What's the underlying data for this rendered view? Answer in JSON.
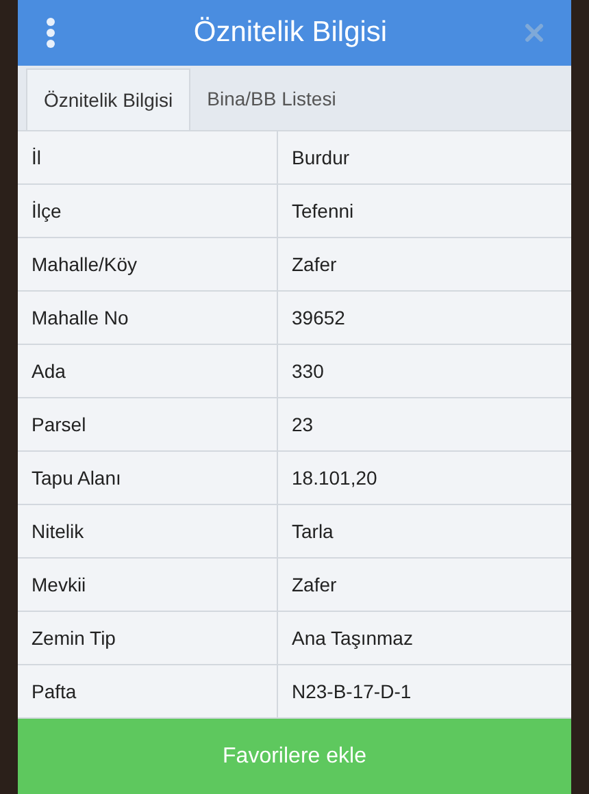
{
  "dialog": {
    "title": "Öznitelik Bilgisi"
  },
  "tabs": [
    {
      "label": "Öznitelik Bilgisi",
      "selected": true
    },
    {
      "label": "Bina/BB Listesi",
      "selected": false
    }
  ],
  "rows": [
    {
      "name": "İl",
      "value": "Burdur"
    },
    {
      "name": "İlçe",
      "value": "Tefenni"
    },
    {
      "name": "Mahalle/Köy",
      "value": "Zafer"
    },
    {
      "name": "Mahalle No",
      "value": "39652"
    },
    {
      "name": "Ada",
      "value": "330"
    },
    {
      "name": "Parsel",
      "value": "23"
    },
    {
      "name": "Tapu Alanı",
      "value": "18.101,20"
    },
    {
      "name": "Nitelik",
      "value": "Tarla"
    },
    {
      "name": "Mevkii",
      "value": "Zafer"
    },
    {
      "name": "Zemin Tip",
      "value": "Ana Taşınmaz"
    },
    {
      "name": "Pafta",
      "value": "N23-B-17-D-1"
    }
  ],
  "button": {
    "label": "Favorilere ekle"
  }
}
